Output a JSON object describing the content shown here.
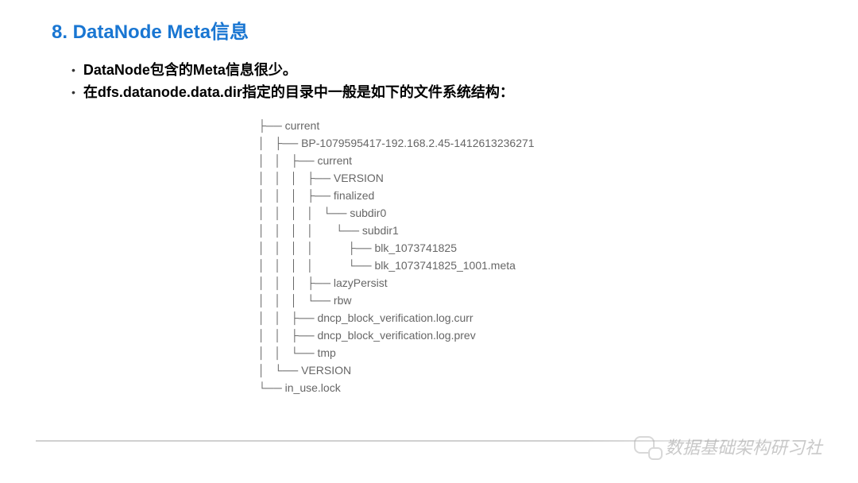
{
  "title": "8. DataNode Meta信息",
  "bullets": [
    "DataNode包含的Meta信息很少。",
    "在dfs.datanode.data.dir指定的目录中一般是如下的文件系统结构："
  ],
  "tree_lines": [
    "├── current",
    "│   ├── BP-1079595417-192.168.2.45-1412613236271",
    "│   │   ├── current",
    "│   │   │   ├── VERSION",
    "│   │   │   ├── finalized",
    "│   │   │   │   └── subdir0",
    "│   │   │   │       └── subdir1",
    "│   │   │   │           ├── blk_1073741825",
    "│   │   │   │           └── blk_1073741825_1001.meta",
    "│   │   │   ├── lazyPersist",
    "│   │   │   └── rbw",
    "│   │   ├── dncp_block_verification.log.curr",
    "│   │   ├── dncp_block_verification.log.prev",
    "│   │   └── tmp",
    "│   └── VERSION",
    "└── in_use.lock"
  ],
  "watermark": "数据基础架构研习社"
}
